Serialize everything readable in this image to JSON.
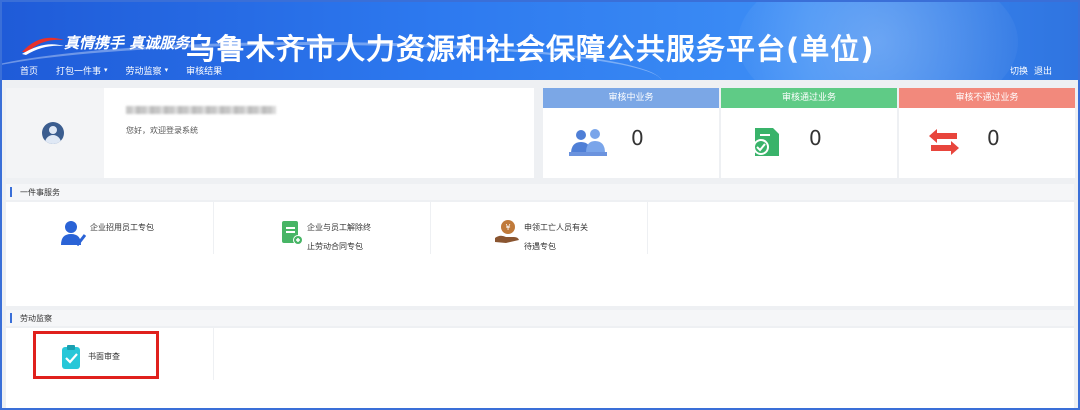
{
  "header": {
    "slogan": "真情携手 真诚服务",
    "title": "乌鲁木齐市人力资源和社会保障公共服务平台(单位)",
    "nav": [
      {
        "label": "首页",
        "has_dropdown": false
      },
      {
        "label": "打包一件事",
        "has_dropdown": true
      },
      {
        "label": "劳动监察",
        "has_dropdown": true
      },
      {
        "label": "审核结果",
        "has_dropdown": false
      }
    ],
    "actions": {
      "switch_label": "切换",
      "logout_label": "退出"
    },
    "colors": {
      "banner": "#2d79ef"
    }
  },
  "user": {
    "welcome": "您好，欢迎登录系统"
  },
  "stats": [
    {
      "label": "审核中业务",
      "value": "0",
      "color": "#7ba7e6",
      "icon": "people-icon"
    },
    {
      "label": "审核通过业务",
      "value": "0",
      "color": "#5fcb86",
      "icon": "approved-doc-icon"
    },
    {
      "label": "审核不通过业务",
      "value": "0",
      "color": "#f2897c",
      "icon": "reject-arrows-icon"
    }
  ],
  "sections": {
    "one_thing": {
      "title": "一件事服务",
      "items": [
        {
          "line1": "企业招用员工专包",
          "line2": "",
          "icon": "employee-hire-icon"
        },
        {
          "line1": "企业与员工解除终",
          "line2": "止劳动合同专包",
          "icon": "contract-termination-icon"
        },
        {
          "line1": "申领工亡人员有关",
          "line2": "待遇专包",
          "icon": "benefit-claim-icon"
        }
      ]
    },
    "labor_inspection": {
      "title": "劳动监察",
      "items": [
        {
          "line1": "书面审查",
          "icon": "clipboard-check-icon"
        }
      ]
    }
  }
}
